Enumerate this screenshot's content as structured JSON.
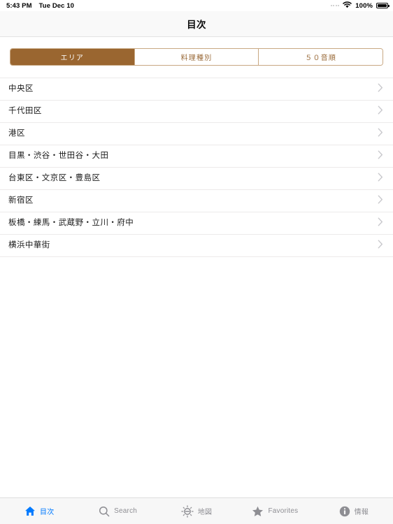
{
  "status_bar": {
    "time": "5:43 PM",
    "date": "Tue Dec 10",
    "wifi_icon": "wifi-icon",
    "battery_percent": "100%",
    "battery_icon": "battery-full-icon",
    "dots_icon": "signal-dots-icon"
  },
  "nav": {
    "title": "目次"
  },
  "segmented_control": {
    "selected_index": 0,
    "active_bg": "#9a6630",
    "inactive_text": "#9a6b3a",
    "border": "#c8a882",
    "segments": [
      {
        "label": "エリア"
      },
      {
        "label": "料理種別"
      },
      {
        "label": "５０音順"
      }
    ]
  },
  "list": {
    "disclosure_icon": "chevron-right-icon",
    "rows": [
      {
        "label": "中央区"
      },
      {
        "label": "千代田区"
      },
      {
        "label": "港区"
      },
      {
        "label": "目黒・渋谷・世田谷・大田"
      },
      {
        "label": "台東区・文京区・豊島区"
      },
      {
        "label": "新宿区"
      },
      {
        "label": "板橋・練馬・武蔵野・立川・府中"
      },
      {
        "label": "横浜中華街"
      }
    ]
  },
  "tabbar": {
    "selected_index": 0,
    "active_color": "#007aff",
    "inactive_color": "#8e8e93",
    "tabs": [
      {
        "label": "目次",
        "icon": "home-icon"
      },
      {
        "label": "Search",
        "icon": "search-icon"
      },
      {
        "label": "地図",
        "icon": "compass-icon"
      },
      {
        "label": "Favorites",
        "icon": "star-icon"
      },
      {
        "label": "情報",
        "icon": "info-icon"
      }
    ]
  }
}
